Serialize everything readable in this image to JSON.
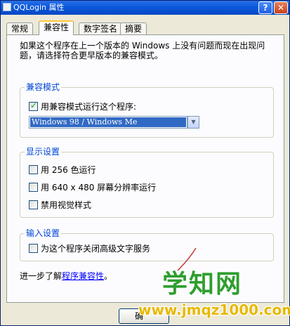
{
  "window": {
    "title": "QQLogin 属性",
    "help_label": "?",
    "close_label": "✕"
  },
  "tabs": [
    {
      "label": "常规",
      "active": false
    },
    {
      "label": "兼容性",
      "active": true
    },
    {
      "label": "数字签名",
      "active": false
    },
    {
      "label": "摘要",
      "active": false
    }
  ],
  "intro_text": "如果这个程序在上一个版本的 Windows 上没有问题而现在出现问题，请选择符合更早版本的兼容模式。",
  "compat_mode": {
    "legend": "兼容模式",
    "checkbox_label": "用兼容模式运行这个程序:",
    "checked": true,
    "selected_os": "Windows 98 / Windows Me"
  },
  "display": {
    "legend": "显示设置",
    "options": [
      {
        "label": "用 256 色运行",
        "checked": false
      },
      {
        "label": "用 640 x 480 屏幕分辨率运行",
        "checked": false
      },
      {
        "label": "禁用视觉样式",
        "checked": false
      }
    ]
  },
  "input": {
    "legend": "输入设置",
    "option_label": "为这个程序关闭高级文字服务",
    "checked": false
  },
  "footer": {
    "prefix": "进一步了解",
    "link": "程序兼容性",
    "suffix": "。"
  },
  "buttons": {
    "ok_partial": "确"
  },
  "watermark": {
    "main": "学知网",
    "url": "www.jmqz1000.com"
  },
  "colors": {
    "title_bar": "#0b58dc",
    "group_legend": "#0046d5",
    "selection": "#316ac5",
    "watermark_green": "#2f9e2f",
    "watermark_yellow": "#e8b800"
  }
}
